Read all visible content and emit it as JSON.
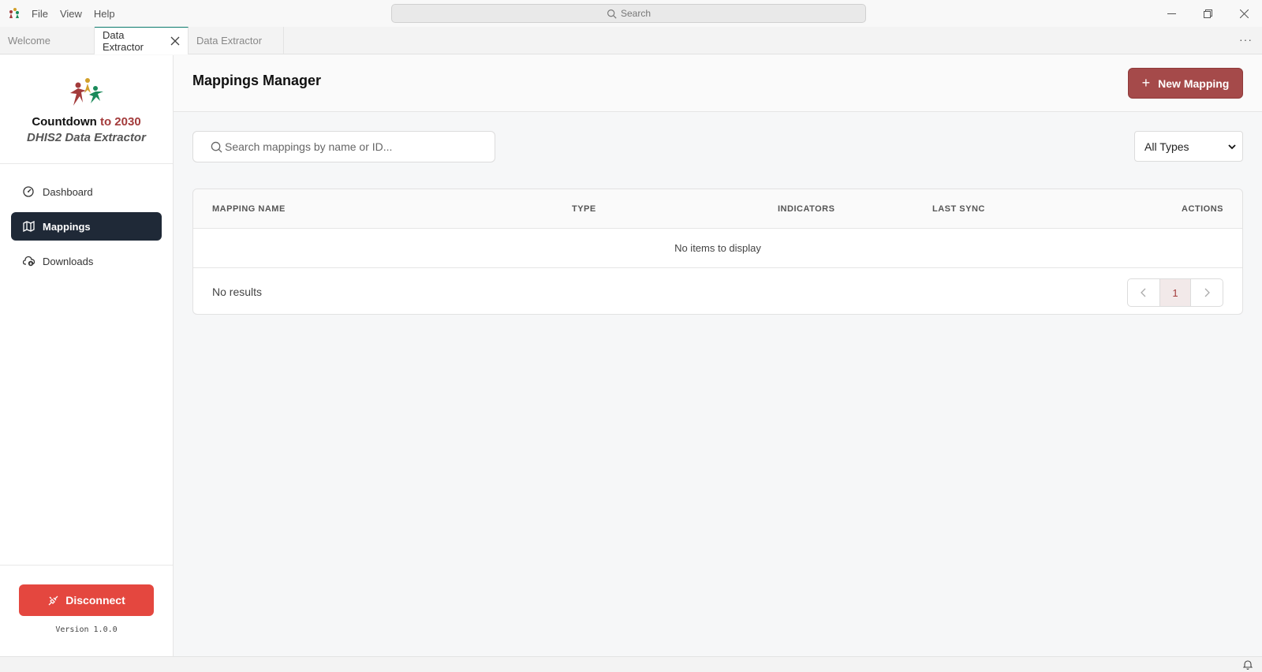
{
  "titlebar": {
    "menus": [
      "File",
      "View",
      "Help"
    ],
    "search_placeholder": "Search"
  },
  "tabs": [
    {
      "label": "Welcome",
      "active": false
    },
    {
      "label": "Data Extractor",
      "active": true
    },
    {
      "label": "Data Extractor",
      "active": false
    }
  ],
  "sidebar": {
    "brand_title_a": "Countdown",
    "brand_title_b": "to 2030",
    "brand_sub": "DHIS2 Data Extractor",
    "items": [
      {
        "label": "Dashboard",
        "icon": "gauge-icon"
      },
      {
        "label": "Mappings",
        "icon": "map-icon",
        "active": true
      },
      {
        "label": "Downloads",
        "icon": "cloud-download-icon"
      }
    ],
    "disconnect_label": "Disconnect",
    "version": "Version 1.0.0"
  },
  "main": {
    "title": "Mappings Manager",
    "new_button": "New Mapping",
    "search_placeholder": "Search mappings by name or ID...",
    "type_filter": "All Types",
    "columns": [
      "MAPPING NAME",
      "TYPE",
      "INDICATORS",
      "LAST SYNC",
      "ACTIONS"
    ],
    "empty_text": "No items to display",
    "results_text": "No results",
    "current_page": "1"
  },
  "colors": {
    "accent": "#a54a4a",
    "danger": "#e4473f",
    "nav_active": "#1f2937"
  }
}
